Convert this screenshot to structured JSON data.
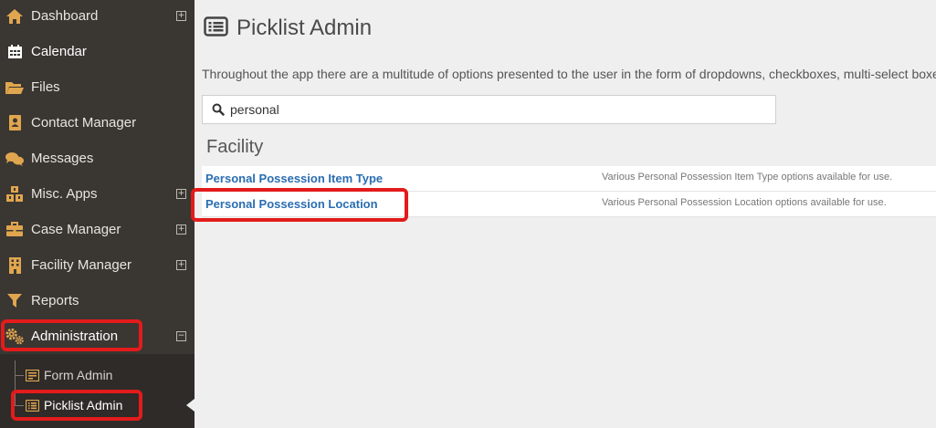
{
  "sidebar": {
    "items": [
      {
        "label": "Dashboard",
        "icon": "home-icon"
      },
      {
        "label": "Calendar",
        "icon": "calendar-icon"
      },
      {
        "label": "Files",
        "icon": "folder-icon"
      },
      {
        "label": "Contact Manager",
        "icon": "contact-card-icon"
      },
      {
        "label": "Messages",
        "icon": "chat-icon"
      },
      {
        "label": "Misc. Apps",
        "icon": "cubes-icon"
      },
      {
        "label": "Case Manager",
        "icon": "briefcase-icon"
      },
      {
        "label": "Facility Manager",
        "icon": "building-icon"
      },
      {
        "label": "Reports",
        "icon": "filter-icon"
      },
      {
        "label": "Administration",
        "icon": "gears-icon"
      }
    ],
    "expand_symbol": "+",
    "collapse_symbol": "−",
    "subitems": [
      {
        "label": "Form Admin",
        "icon": "form-icon"
      },
      {
        "label": "Picklist Admin",
        "icon": "list-icon"
      }
    ]
  },
  "header": {
    "title": "Picklist Admin",
    "icon": "list-icon"
  },
  "description": "Throughout the app there are a multitude of options presented to the user in the form of dropdowns, checkboxes, multi-select boxes",
  "search": {
    "value": "personal",
    "icon": "search-icon"
  },
  "section": {
    "title": "Facility"
  },
  "rows": [
    {
      "name": "Personal Possession Item Type",
      "description": "Various Personal Possession Item Type options available for use."
    },
    {
      "name": "Personal Possession Location",
      "description": "Various Personal Possession Location options available for use."
    }
  ],
  "colors": {
    "sidebar_bg": "#3a3632",
    "icon_accent": "#e0a64f",
    "link": "#2a6db1",
    "highlight": "#e31b1b"
  }
}
